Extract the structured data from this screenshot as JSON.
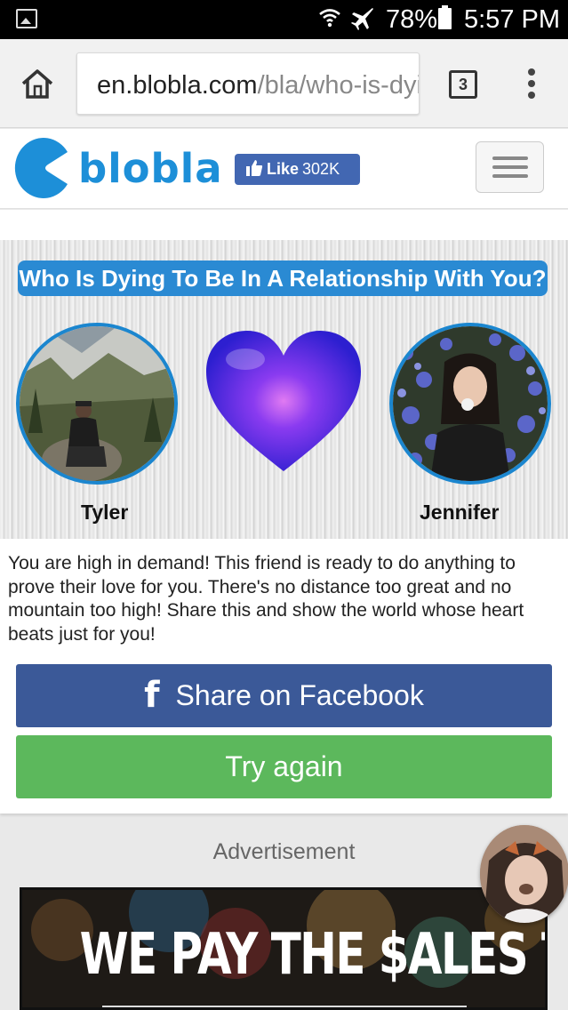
{
  "status_bar": {
    "battery_percent": "78%",
    "time": "5:57 PM"
  },
  "browser": {
    "url_domain": "en.blobla.com",
    "url_path": "/bla/who-is-dying",
    "tab_count": "3"
  },
  "site_header": {
    "logo_text": "blobla",
    "like_label": "Like",
    "like_count": "302K",
    "brand_color": "#1d8fd8"
  },
  "result": {
    "title": "Who Is Dying To Be In A Relationship With You?",
    "left_name": "Tyler",
    "right_name": "Jennifer",
    "description": "You are high in demand! This friend is ready to do anything to prove their love for you. There's no distance too great and no mountain too high! Share this and show the world whose heart beats just for you!"
  },
  "actions": {
    "share_label": "Share on Facebook",
    "try_again_label": "Try again",
    "facebook_color": "#3b5998",
    "try_again_color": "#5cb85c"
  },
  "ad": {
    "label": "Advertisement",
    "headline": "WE PAY THE $ALES TAX"
  }
}
